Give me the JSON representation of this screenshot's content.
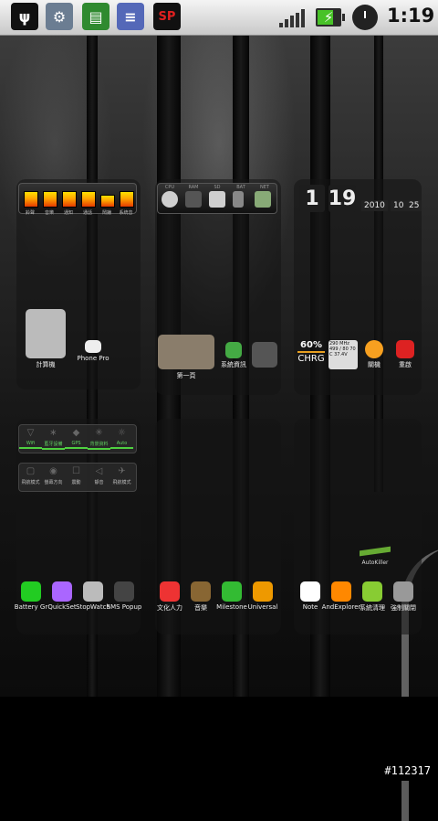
{
  "status_bar": {
    "time": "1:19",
    "icons": [
      "usb-icon",
      "settings-icon",
      "book-icon",
      "list-icon",
      "sp-icon"
    ],
    "sp_text": "SP",
    "battery_charging": true
  },
  "widgets": {
    "volume": {
      "labels": [
        "鈴聲",
        "音樂",
        "通知",
        "通話",
        "鬧鐘",
        "系統音"
      ],
      "levels": [
        0.9,
        0.9,
        0.9,
        0.9,
        0.7,
        0.9
      ]
    },
    "devices": {
      "labels": [
        "CPU",
        "RAM",
        "SD",
        "BAT",
        "NET"
      ]
    },
    "clock": {
      "hour": "1",
      "minute": "19",
      "year": "2010",
      "month": "10",
      "day": "25"
    },
    "battery": {
      "percent": "60%",
      "state": "CHRG",
      "info": "290 MHz 499 / 80 70 C 37.4V"
    }
  },
  "apps": {
    "row_top": [
      {
        "name": "計算機",
        "icon": "calculator-icon",
        "color": "#d44"
      },
      {
        "name": "Phone Pro",
        "icon": "phone-icon",
        "color": "#222"
      },
      {
        "name": "第一頁",
        "icon": "photo-icon",
        "color": "#777"
      },
      {
        "name": "系統資訊",
        "icon": "info-icon",
        "color": "#2a2"
      },
      {
        "name": "",
        "icon": "trash-icon",
        "color": "#555"
      },
      {
        "name": "關機",
        "icon": "power-icon",
        "color": "#f7a020"
      },
      {
        "name": "重啟",
        "icon": "restart-icon",
        "color": "#d22"
      }
    ],
    "row_bottom": [
      {
        "name": "Battery Gr",
        "icon": "battery-graph-icon",
        "color": "#2c2"
      },
      {
        "name": "QuickSet",
        "icon": "quickset-icon",
        "color": "#a6f"
      },
      {
        "name": "StopWatch",
        "icon": "stopwatch-icon",
        "color": "#bbb"
      },
      {
        "name": "SMS Popup",
        "icon": "sms-icon",
        "color": "#444"
      },
      {
        "name": "文化人力",
        "icon": "cube-icon",
        "color": "#e33"
      },
      {
        "name": "音樂",
        "icon": "music-icon",
        "color": "#863"
      },
      {
        "name": "Milestone",
        "icon": "android-icon",
        "color": "#3b3"
      },
      {
        "name": "Universal",
        "icon": "unlock-icon",
        "color": "#e90"
      },
      {
        "name": "Note",
        "icon": "note-icon",
        "color": "#fff"
      },
      {
        "name": "AndExplorer",
        "icon": "explorer-icon",
        "color": "#f80"
      },
      {
        "name": "系統清理",
        "icon": "robot-icon",
        "color": "#8c3"
      },
      {
        "name": "強制關閉",
        "icon": "kill-icon",
        "color": "#999"
      }
    ],
    "auto_killer": "AutoKiller"
  },
  "toggles": {
    "row1": [
      {
        "label": "Wifi",
        "on": true
      },
      {
        "label": "藍牙設備",
        "on": true
      },
      {
        "label": "GPS",
        "on": true
      },
      {
        "label": "背景資料",
        "on": true
      },
      {
        "label": "Auto",
        "on": true
      }
    ],
    "row2": [
      {
        "label": "飛航模式",
        "on": false
      },
      {
        "label": "螢幕方向",
        "on": false
      },
      {
        "label": "震動",
        "on": false
      },
      {
        "label": "靜音",
        "on": false
      },
      {
        "label": "飛航模式",
        "on": false
      }
    ]
  },
  "watermark": "#112317"
}
